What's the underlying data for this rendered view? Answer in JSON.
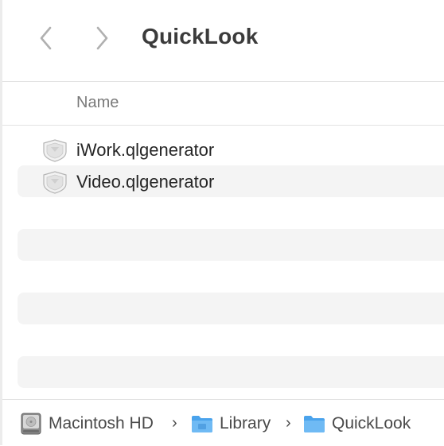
{
  "toolbar": {
    "title": "QuickLook",
    "back_icon": "chevron-left-icon",
    "forward_icon": "chevron-right-icon"
  },
  "columns": {
    "name_label": "Name"
  },
  "files": [
    {
      "name": "iWork.qlgenerator",
      "icon": "qlgenerator-plugin-icon"
    },
    {
      "name": "Video.qlgenerator",
      "icon": "qlgenerator-plugin-icon"
    }
  ],
  "pathbar": {
    "items": [
      {
        "label": "Macintosh HD",
        "icon": "hard-drive-icon"
      },
      {
        "label": "Library",
        "icon": "folder-icon"
      },
      {
        "label": "QuickLook",
        "icon": "folder-icon"
      }
    ],
    "separator": "›"
  },
  "colors": {
    "folder_blue": "#5aaef0",
    "stripe": "#f4f4f4",
    "chevron_gray": "#b0b0b0"
  }
}
